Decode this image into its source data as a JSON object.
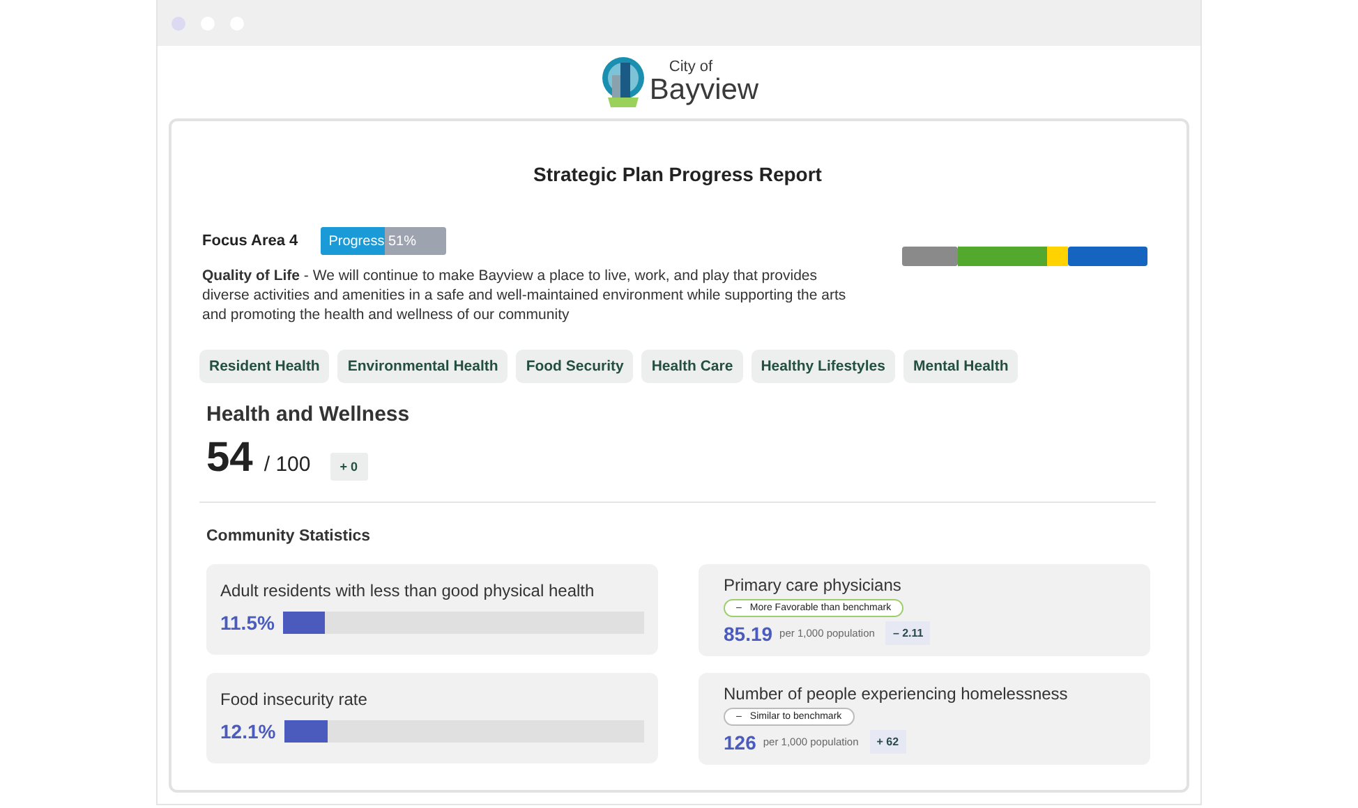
{
  "logo": {
    "small": "City of",
    "large": "Bayview"
  },
  "report": {
    "title": "Strategic Plan Progress Report",
    "focus_area": "Focus Area 4",
    "progress": {
      "label": "Progress 51%",
      "level": 0.51
    },
    "description": "**Quality of Life** - We will continue to make Bayview a place to live, work, and play that provides diverse activities and amenities in a safe and well-maintained environment while supporting the arts and promoting the health and wellness of our community",
    "tabs": [
      {
        "label": "Resident Health"
      },
      {
        "label": "Environmental Health"
      },
      {
        "label": "Food Security"
      },
      {
        "label": "Health Care"
      },
      {
        "label": "Healthy Lifestyles"
      },
      {
        "label": "Mental Health"
      }
    ],
    "section": {
      "title": "Health and Wellness",
      "score": "54",
      "out_of": "/ 100",
      "change": "+ 0"
    },
    "stats_title": "Community Statistics",
    "left_stats": [
      {
        "label": "Adult residents with less than good physical health",
        "value": "11.5%",
        "level": 0.115
      },
      {
        "label": "Food insecurity rate",
        "value": "12.1%",
        "level": 0.121
      }
    ],
    "right_stats": [
      {
        "label": "Primary care physicians",
        "badge": {
          "kind": "favorable",
          "symbol": "–",
          "text": "More Favorable than benchmark"
        },
        "value": "85.19",
        "unit": "per 1,000 population",
        "change": "– 2.11"
      },
      {
        "label": "Number of people experiencing homelessness",
        "badge": {
          "kind": "similar",
          "symbol": "–",
          "text": "Similar to benchmark"
        },
        "value": "126",
        "unit": "per 1,000 population",
        "change": "+ 62"
      }
    ]
  }
}
